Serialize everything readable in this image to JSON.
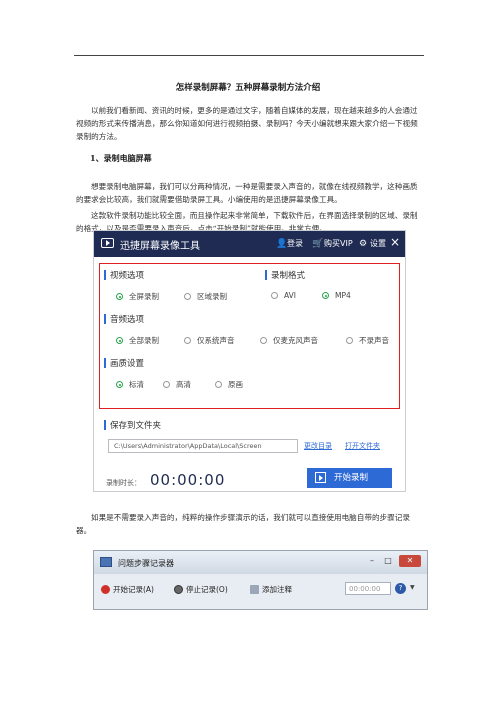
{
  "article": {
    "title": "怎样录制屏幕？五种屏幕录制方法介绍",
    "intro": "以前我们看新闻、资讯的时候，更多的是通过文字，随着自媒体的发展，现在越来越多的人会通过视频的形式来传播消息，那么你知道如何进行视频拍摄、录制吗？今天小编就想来跟大家介绍一下视频录制的方法。",
    "section1_heading": "1、录制电脑屏幕",
    "para1": "想要录制电脑屏幕，我们可以分两种情况，一种是需要录入声音的，就像在线视频教学，这种画质的要求会比较高，我们就需要借助录屏工具。小编使用的是迅捷屏幕录像工具。",
    "para2": "这款软件录制功能比较全面，而且操作起来非常简单，下载软件后，在界面选择录制的区域、录制的格式，以及是否需要录入声音后，点击“开始录制”就能使用。非常方便。",
    "para3": "如果是不需要录入声音的，纯粹的操作步骤演示的话，我们就可以直接使用电脑自带的步骤记录器。"
  },
  "recorder_app": {
    "title": "迅捷屏幕录像工具",
    "login": "登录",
    "buy_vip": "购买VIP",
    "settings": "设置",
    "video_options_label": "视频选项",
    "video_options": [
      "全屏录制",
      "区域录制"
    ],
    "video_selected": 0,
    "format_label": "录制格式",
    "formats": [
      "AVI",
      "MP4"
    ],
    "format_selected": 1,
    "audio_options_label": "音频选项",
    "audio_options": [
      "全部录制",
      "仅系统声音",
      "仅麦克风声音",
      "不录声音"
    ],
    "audio_selected": 0,
    "quality_label": "画质设置",
    "quality_options": [
      "标清",
      "高清",
      "原画"
    ],
    "quality_selected": 0,
    "save_label": "保存到文件夹",
    "save_path": "C:\\Users\\Administrator\\AppData\\Local\\Screen",
    "change_dir": "更改目录",
    "open_folder": "打开文件夹",
    "duration_label": "录制时长：",
    "duration": "00:00:00",
    "start_button": "开始录制"
  },
  "steps_recorder": {
    "title": "问题步骤记录器",
    "start": "开始记录(A)",
    "stop": "停止记录(O)",
    "add_comment": "添加注释",
    "timer": "00:00:00",
    "help": "?"
  },
  "colors": {
    "app_bar": "#1f2b52",
    "accent_blue": "#2d6ad6",
    "highlight_red": "#e02020",
    "radio_green": "#2aa34a"
  }
}
